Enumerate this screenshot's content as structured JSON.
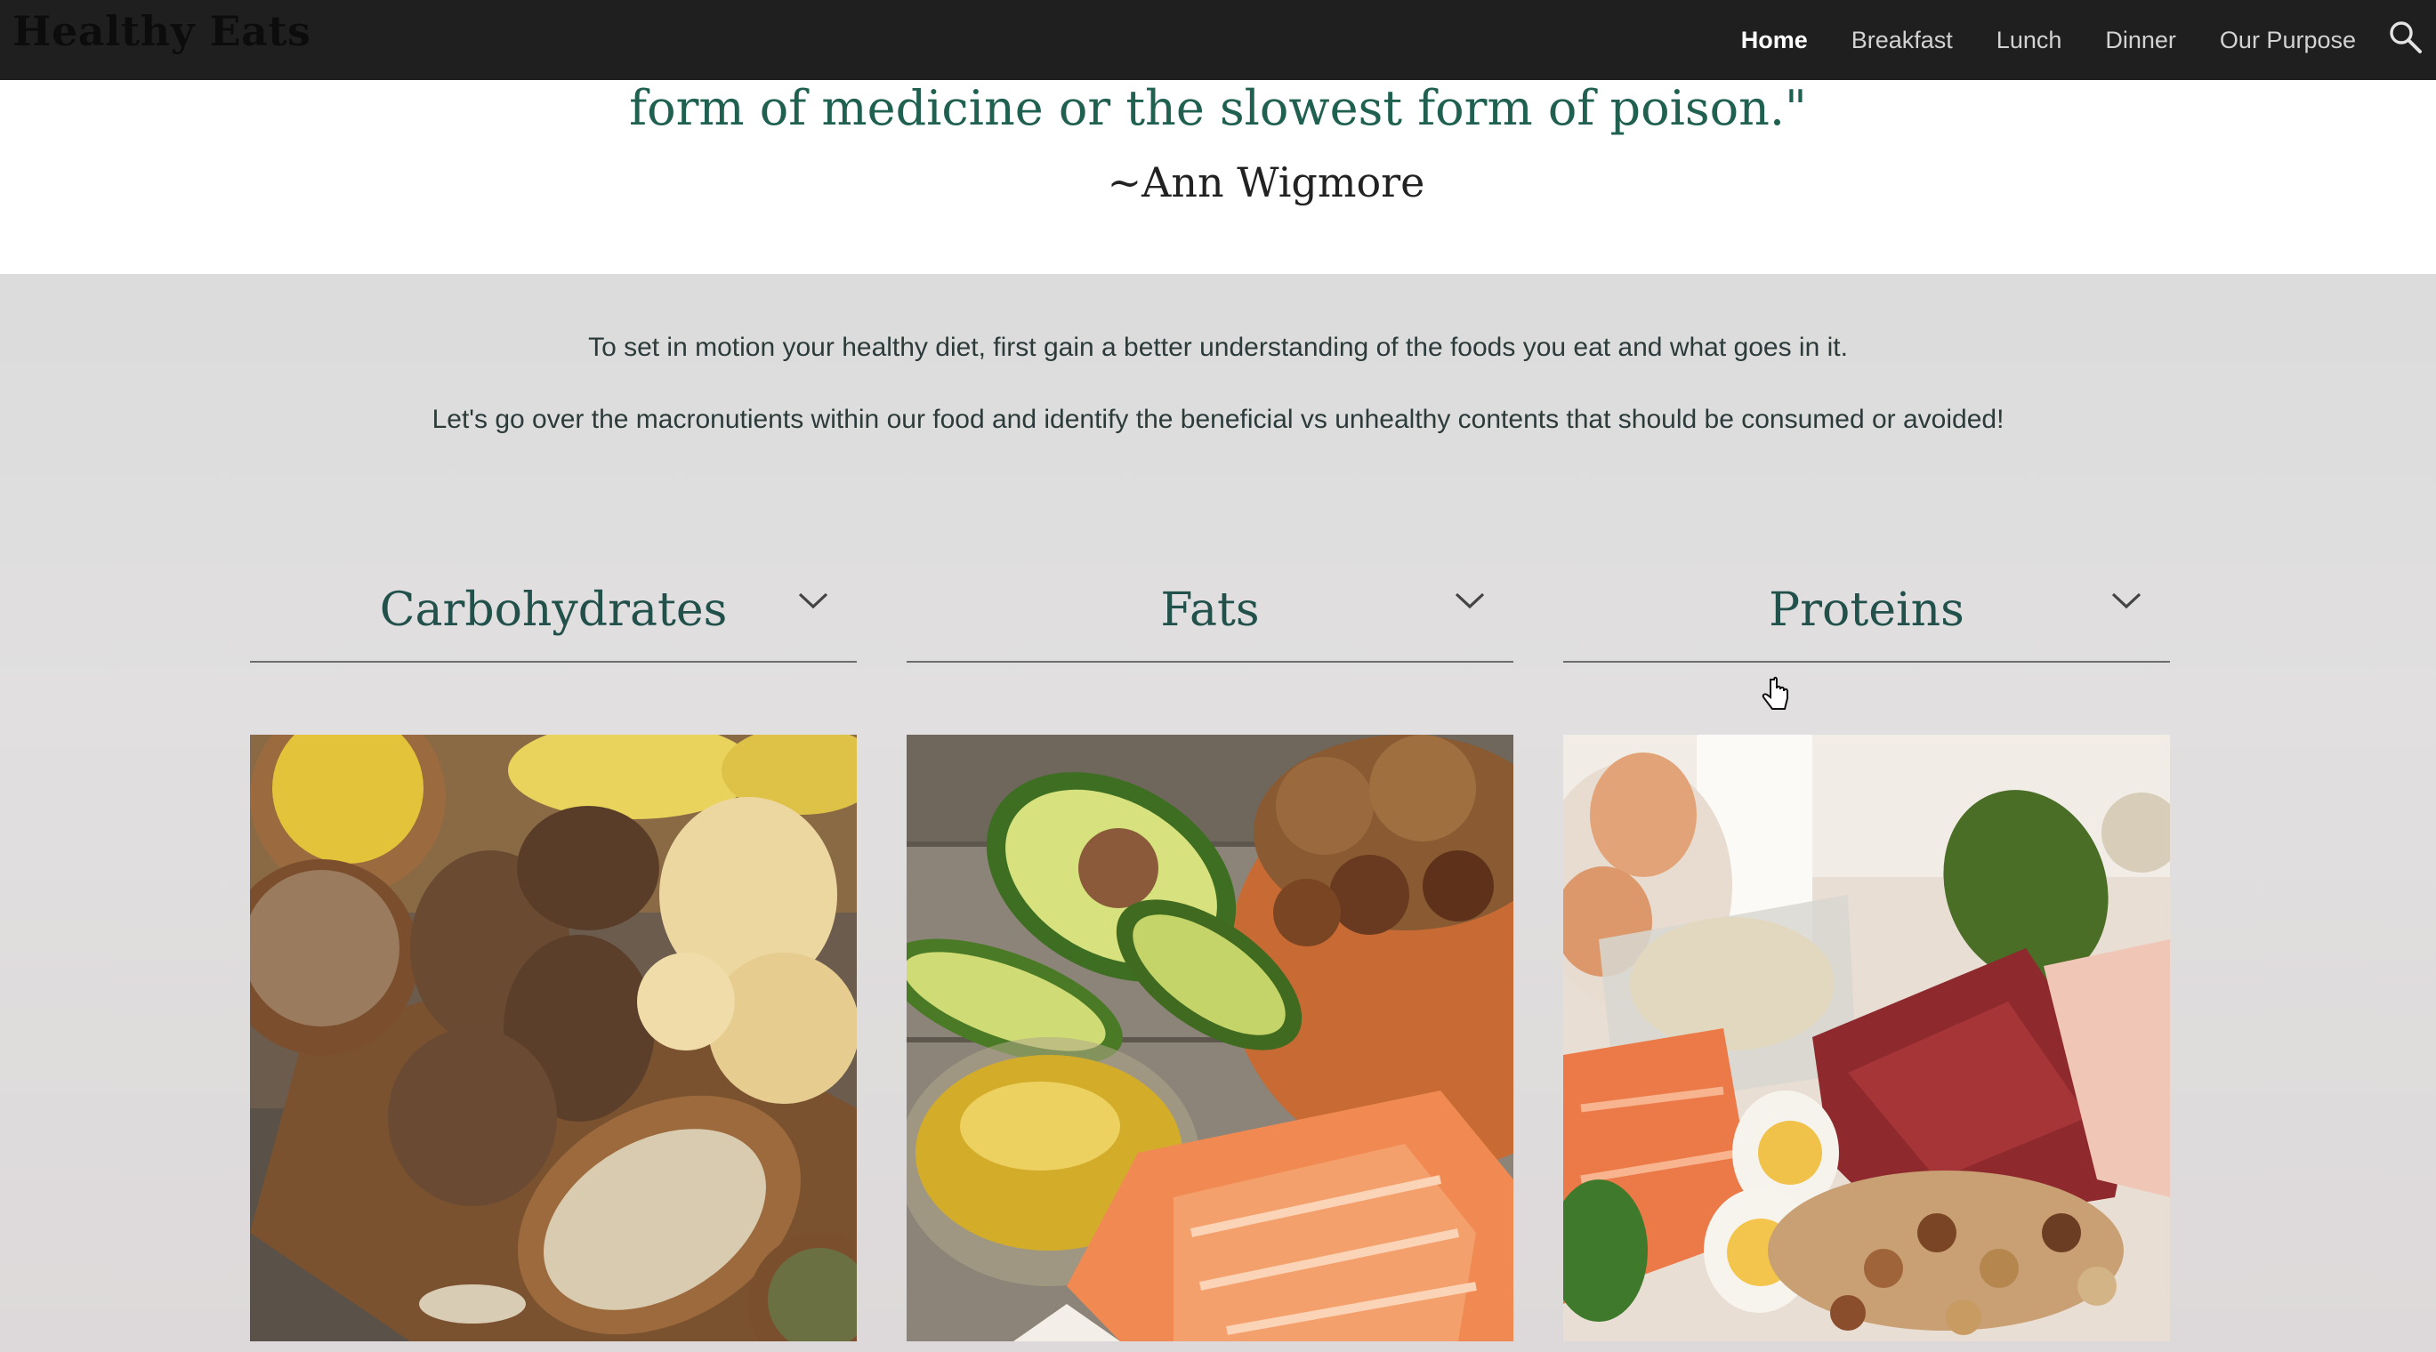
{
  "nav": {
    "brand": "Healthy Eats",
    "items": [
      {
        "label": "Home",
        "active": true
      },
      {
        "label": "Breakfast",
        "active": false
      },
      {
        "label": "Lunch",
        "active": false
      },
      {
        "label": "Dinner",
        "active": false
      },
      {
        "label": "Our Purpose",
        "active": false
      }
    ],
    "search_icon": "search-icon"
  },
  "quote": {
    "line": "form of medicine or the slowest form of poison.\"",
    "author": "~Ann Wigmore"
  },
  "intro": {
    "line1": "To set in motion your healthy diet, first gain a better understanding of the foods you eat and what goes in it.",
    "line2": "Let's go over the macronutients within our food and identify the beneficial vs unhealthy contents that should be consumed or avoided!"
  },
  "sections": [
    {
      "title": "Carbohydrates",
      "icon": "chevron-down-icon"
    },
    {
      "title": "Fats",
      "icon": "chevron-down-icon"
    },
    {
      "title": "Proteins",
      "icon": "chevron-down-icon"
    }
  ],
  "colors": {
    "topbar": "#1f1f1f",
    "accent_green": "#1f6050",
    "heading_green": "#22504a"
  }
}
